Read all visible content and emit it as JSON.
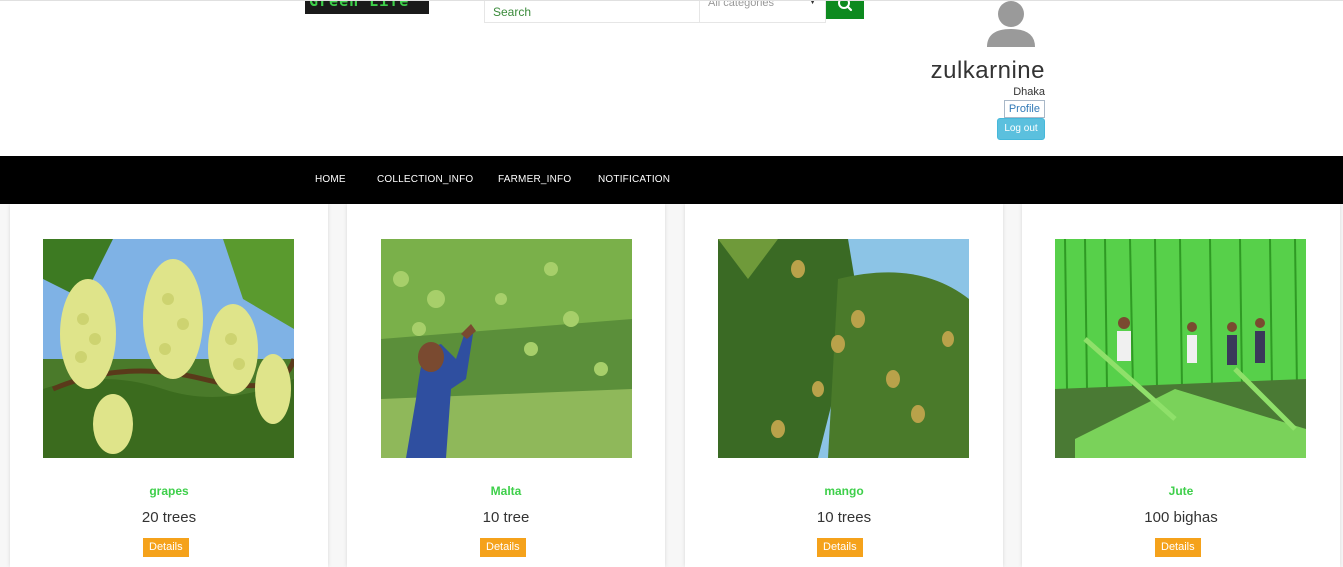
{
  "brand": {
    "logo_text": "Green Life"
  },
  "search": {
    "placeholder": "Search",
    "category_value": "All categories"
  },
  "user": {
    "name": "zulkarnine",
    "city": "Dhaka",
    "profile_label": "Profile",
    "logout_label": "Log out"
  },
  "nav": {
    "items": [
      {
        "label": "HOME"
      },
      {
        "label": "COLLECTION_INFO"
      },
      {
        "label": "FARMER_INFO"
      },
      {
        "label": "NOTIFICATION"
      }
    ]
  },
  "products": [
    {
      "name": "grapes",
      "quantity": "20 trees",
      "button_label": "Details",
      "image": "grapes-photo"
    },
    {
      "name": "Malta",
      "quantity": "10 tree",
      "button_label": "Details",
      "image": "malta-farmer-photo"
    },
    {
      "name": "mango",
      "quantity": "10 trees",
      "button_label": "Details",
      "image": "mango-tree-photo"
    },
    {
      "name": "Jute",
      "quantity": "100 bighas",
      "button_label": "Details",
      "image": "jute-field-photo"
    }
  ],
  "colors": {
    "accent_green": "#3ecf4a",
    "search_button": "#0d8a1f",
    "details_button": "#f5a21b",
    "logout_button": "#5bc0de",
    "navbar": "#000000"
  }
}
